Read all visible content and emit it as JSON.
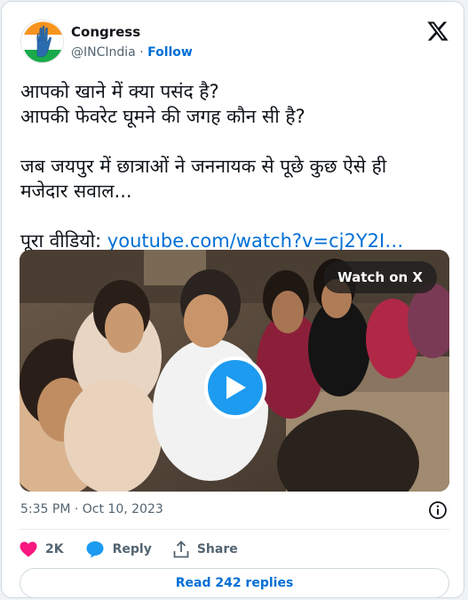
{
  "author": {
    "name": "Congress",
    "handle": "@INCIndia",
    "separator": "·",
    "follow_label": "Follow"
  },
  "tweet": {
    "lines_1": [
      "आपको खाने में क्या पसंद है?",
      "आपकी फेवरेट घूमने की जगह कौन सी है?"
    ],
    "lines_2": [
      "जब जयपुर में छात्राओं ने जननायक से पूछे कुछ ऐसे ही",
      "मजेदार सवाल..."
    ],
    "video_prefix": "पूरा वीडियो: ",
    "video_link": "youtube.com/watch?v=cj2Y2I…"
  },
  "media": {
    "watch_label": "Watch on X"
  },
  "meta": {
    "timestamp": "5:35 PM · Oct 10, 2023"
  },
  "actions": {
    "likes": "2K",
    "reply_label": "Reply",
    "share_label": "Share"
  },
  "read_replies": "Read 242 replies",
  "colors": {
    "accent": "#006fd6",
    "like": "#f91880",
    "play": "#1d9bf0"
  }
}
